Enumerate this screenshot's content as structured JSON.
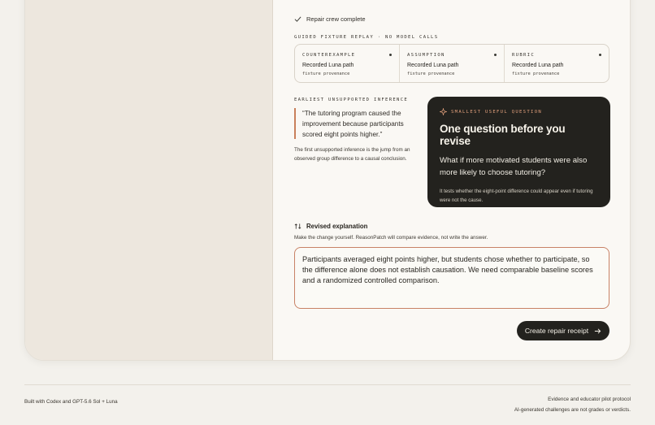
{
  "status": {
    "repair_crew": "Repair crew complete"
  },
  "replay": {
    "label": "GUIDED FIXTURE REPLAY · NO MODEL CALLS",
    "cells": [
      {
        "title": "COUNTEREXAMPLE",
        "path": "Recorded Luna path",
        "provenance": "fixture provenance"
      },
      {
        "title": "ASSUMPTION",
        "path": "Recorded Luna path",
        "provenance": "fixture provenance"
      },
      {
        "title": "RUBRIC",
        "path": "Recorded Luna path",
        "provenance": "fixture provenance"
      }
    ]
  },
  "inference": {
    "label": "EARLIEST UNSUPPORTED INFERENCE",
    "quote": "“The tutoring program caused the improvement because participants scored eight points higher.”",
    "description": "The first unsupported inference is the jump from an observed group difference to a causal conclusion."
  },
  "question_card": {
    "eyebrow": "SMALLEST USEFUL QUESTION",
    "title": "One question before you revise",
    "question": "What if more motivated students were also more likely to choose tutoring?",
    "explanation": "It tests whether the eight-point difference could appear even if tutoring were not the cause."
  },
  "revision": {
    "heading": "Revised explanation",
    "subtext": "Make the change yourself. ReasonPatch will compare evidence, not write the answer.",
    "value": "Participants averaged eight points higher, but students chose whether to participate, so the difference alone does not establish causation. We need comparable baseline scores and a randomized controlled comparison."
  },
  "actions": {
    "create_receipt": "Create repair receipt"
  },
  "footer": {
    "left": "Built with Codex and GPT-5.6 Sol + Luna",
    "right_line1": "Evidence and educator pilot protocol",
    "right_line2": "AI-generated challenges are not grades or verdicts."
  },
  "colors": {
    "accent": "#c9805a",
    "dark_card": "#23221e",
    "background": "#f3f1ec"
  },
  "icons": [
    "check-icon",
    "sparkle-icon",
    "revise-swap-icon",
    "arrow-right-icon"
  ]
}
